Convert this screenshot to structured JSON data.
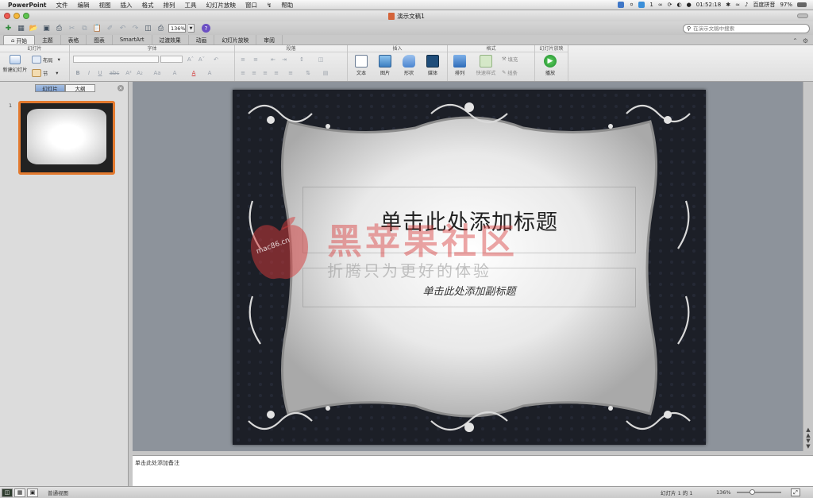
{
  "menubar": {
    "app_name": "PowerPoint",
    "items": [
      "文件",
      "编辑",
      "视图",
      "插入",
      "格式",
      "排列",
      "工具",
      "幻灯片放映",
      "窗口",
      "帮助"
    ],
    "right": {
      "count": "1",
      "clock": "01:52:18",
      "input_method": "百度拼音",
      "battery": "97%"
    }
  },
  "window": {
    "title": "演示文稿1"
  },
  "toolbar": {
    "zoom_value": "136%",
    "search_placeholder": "在演示文稿中搜索"
  },
  "ribbon_tabs": [
    "开始",
    "主题",
    "表格",
    "图表",
    "SmartArt",
    "过渡效果",
    "动画",
    "幻灯片放映",
    "审阅"
  ],
  "ribbon": {
    "groups": {
      "slides": "幻灯片",
      "font": "字体",
      "paragraph": "段落",
      "insert": "插入",
      "format": "格式",
      "slideshow": "幻灯片放映"
    },
    "new_slide": "新建幻灯片",
    "layout": "布局",
    "section": "节",
    "text": "文本",
    "picture": "图片",
    "shape": "形状",
    "media": "媒体",
    "arrange": "排列",
    "quick_styles": "快速样式",
    "fill": "填充",
    "line": "线条",
    "play": "播放"
  },
  "left_pane": {
    "tabs": [
      "幻灯片",
      "大纲"
    ],
    "slide_number": "1"
  },
  "slide": {
    "title_placeholder": "单击此处添加标题",
    "subtitle_placeholder": "单击此处添加副标题"
  },
  "watermark": {
    "main": "黑苹果社区",
    "tagline": "折腾只为更好的体验",
    "url": "mac86.cn"
  },
  "notes": {
    "placeholder": "单击此处添加备注"
  },
  "status": {
    "view_mode": "普通视图",
    "slide_count": "幻灯片 1 的 1",
    "zoom": "136%"
  },
  "colors": {
    "accent_orange": "#e37a2f",
    "slide_bg": "#1d2028",
    "watermark_red": "#d63a3a"
  }
}
